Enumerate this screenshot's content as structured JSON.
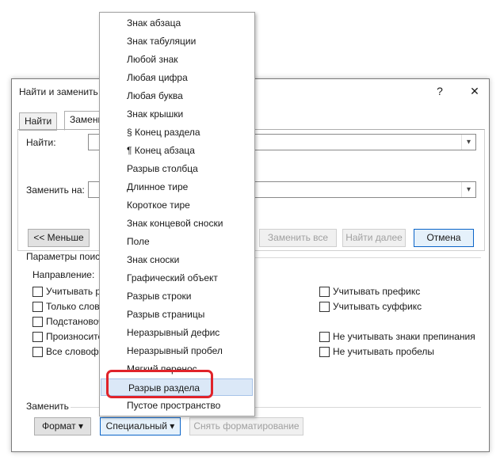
{
  "dialog": {
    "title": "Найти и заменить",
    "help_label": "?",
    "close_label": "✕",
    "tabs": [
      {
        "label": "Найти"
      },
      {
        "label": "Замени"
      }
    ],
    "find_label": "Найти:",
    "replace_label": "Заменить на:",
    "less_button": "<< Меньше",
    "replace_all_button": "Заменить все",
    "find_next_button": "Найти далее",
    "cancel_button": "Отмена",
    "search_params_label": "Параметры поиск",
    "direction_label": "Направление:",
    "left_checkboxes": [
      {
        "label": "Учитывать р"
      },
      {
        "label": "Только слово"
      },
      {
        "label": "Подстановоч"
      },
      {
        "label": "Произносите"
      },
      {
        "label": "Все словофо"
      }
    ],
    "right_checkboxes": [
      {
        "label": "Учитывать префикс"
      },
      {
        "label": "Учитывать суффикс"
      },
      {
        "label": "Не учитывать знаки препинания"
      },
      {
        "label": "Не учитывать пробелы"
      }
    ],
    "replace_section_label": "Заменить",
    "format_button": "Формат ▾",
    "special_button": "Специальный ▾",
    "clear_format_button": "Снять форматирование"
  },
  "special_menu": {
    "items": [
      {
        "label": "Знак абзаца"
      },
      {
        "label": "Знак табуляции"
      },
      {
        "label": "Любой знак"
      },
      {
        "label": "Любая цифра"
      },
      {
        "label": "Любая буква"
      },
      {
        "label": "Знак крышки"
      },
      {
        "label": "§ Конец раздела"
      },
      {
        "label": "¶ Конец абзаца"
      },
      {
        "label": "Разрыв столбца"
      },
      {
        "label": "Длинное тире"
      },
      {
        "label": "Короткое тире"
      },
      {
        "label": "Знак концевой сноски"
      },
      {
        "label": "Поле"
      },
      {
        "label": "Знак сноски"
      },
      {
        "label": "Графический объект"
      },
      {
        "label": "Разрыв строки"
      },
      {
        "label": "Разрыв страницы"
      },
      {
        "label": "Неразрывный дефис"
      },
      {
        "label": "Неразрывный пробел"
      },
      {
        "label": "Мягкий перенос"
      },
      {
        "label": "Разрыв раздела"
      },
      {
        "label": "Пустое пространство"
      }
    ],
    "highlighted_index": 20,
    "highlight_color": "#e0232a"
  }
}
